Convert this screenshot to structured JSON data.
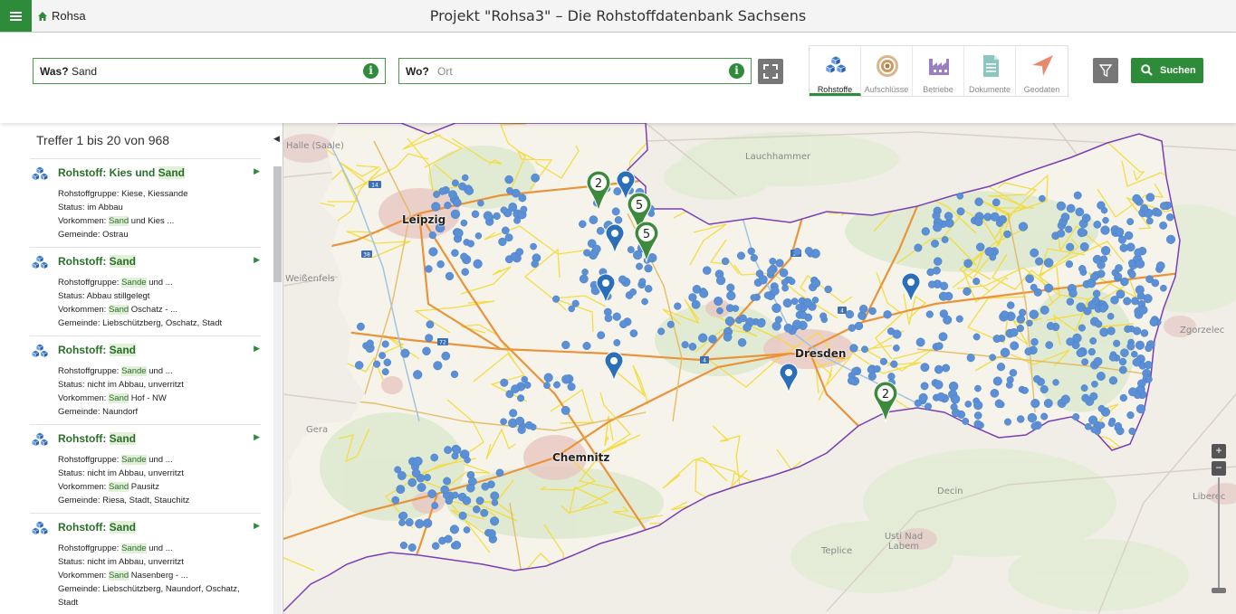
{
  "topbar": {
    "home_label": "Rohsa",
    "title": "Projekt \"Rohsa3\" – Die Rohstoffdatenbank Sachsens"
  },
  "search": {
    "was_label": "Was?",
    "was_value": "Sand",
    "wo_label": "Wo?",
    "wo_placeholder": "Ort",
    "submit_label": "Suchen"
  },
  "categories": [
    {
      "label": "Rohstoffe",
      "icon": "cubes-icon",
      "active": true
    },
    {
      "label": "Aufschlüsse",
      "icon": "target-icon",
      "active": false
    },
    {
      "label": "Betriebe",
      "icon": "factory-icon",
      "active": false
    },
    {
      "label": "Dokumente",
      "icon": "document-icon",
      "active": false
    },
    {
      "label": "Geodaten",
      "icon": "navigation-arrow-icon",
      "active": false
    }
  ],
  "results": {
    "count_text": "Treffer 1 bis 20 von 968",
    "items": [
      {
        "title_prefix": "Rohstoff: Kies und ",
        "title_hl": "Sand",
        "l1_label": "Rohstoffgruppe: ",
        "l1_hl": "",
        "l1_rest": "Kiese, Kiessande",
        "l2": "Status: im Abbau",
        "l3_label": "Vorkommen: ",
        "l3_hl": "Sand",
        "l3_rest": " und Kies ...",
        "l4": "Gemeinde: Ostrau"
      },
      {
        "title_prefix": "Rohstoff: ",
        "title_hl": "Sand",
        "l1_label": "Rohstoffgruppe: ",
        "l1_hl": "Sande",
        "l1_rest": " und ...",
        "l2": "Status: Abbau stillgelegt",
        "l3_label": "Vorkommen: ",
        "l3_hl": "Sand",
        "l3_rest": " Oschatz - ...",
        "l4": "Gemeinde: Liebschützberg, Oschatz, Stadt"
      },
      {
        "title_prefix": "Rohstoff: ",
        "title_hl": "Sand",
        "l1_label": "Rohstoffgruppe: ",
        "l1_hl": "Sande",
        "l1_rest": " und ...",
        "l2": "Status: nicht im Abbau, unverritzt",
        "l3_label": "Vorkommen: ",
        "l3_hl": "Sand",
        "l3_rest": " Hof - NW",
        "l4": "Gemeinde: Naundorf"
      },
      {
        "title_prefix": "Rohstoff: ",
        "title_hl": "Sand",
        "l1_label": "Rohstoffgruppe: ",
        "l1_hl": "Sande",
        "l1_rest": " und ...",
        "l2": "Status: nicht im Abbau, unverritzt",
        "l3_label": "Vorkommen: ",
        "l3_hl": "Sand",
        "l3_rest": " Pausitz",
        "l4": "Gemeinde: Riesa, Stadt, Stauchitz"
      },
      {
        "title_prefix": "Rohstoff: ",
        "title_hl": "Sand",
        "l1_label": "Rohstoffgruppe: ",
        "l1_hl": "Sande",
        "l1_rest": " und ...",
        "l2": "Status: nicht im Abbau, unverritzt",
        "l3_label": "Vorkommen: ",
        "l3_hl": "Sand",
        "l3_rest": " Nasenberg - ...",
        "l4": "Gemeinde: Liebschützberg, Naundorf, Oschatz, Stadt"
      }
    ]
  },
  "map": {
    "places": {
      "leipzig": "Leipzig",
      "dresden": "Dresden",
      "chemnitz": "Chemnitz",
      "halle": "Halle (Saale)",
      "lauchhammer": "Lauchhammer",
      "zgorzelec": "Zgorzelec",
      "decin": "Decin",
      "liberec": "Liberec",
      "usti": "Usti Nad Labem",
      "teplice": "Teplice",
      "weissenfels": "Weißenfels",
      "gera": "Gera"
    },
    "clusters": [
      "2",
      "5",
      "5",
      "2"
    ],
    "zoom_in": "+",
    "zoom_out": "−",
    "colors": {
      "boundary": "#7b3fb5",
      "marker": "#5b8fd6",
      "pin_blue": "#2a6fb8",
      "pin_green": "#3d8a3d"
    }
  }
}
